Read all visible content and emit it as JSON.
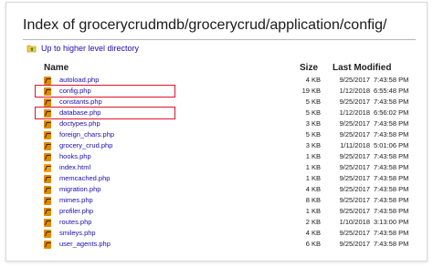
{
  "page": {
    "title": "Index of grocerycrudmdb/grocerycrud/application/config/",
    "up_link": "Up to higher level directory",
    "up_icon": "folder-up-icon"
  },
  "columns": {
    "name": "Name",
    "size": "Size",
    "modified": "Last Modified"
  },
  "colors": {
    "link": "#1a0dab",
    "highlight_border": "#e0142b",
    "file_icon": "#e08a00"
  },
  "files": [
    {
      "name": "autoload.php",
      "size": "4 KB",
      "date": "9/25/2017",
      "time": "7:43:58 PM",
      "icon": "php-file-icon"
    },
    {
      "name": "config.php",
      "size": "19 KB",
      "date": "1/12/2018",
      "time": "6:55:48 PM",
      "icon": "php-file-icon",
      "highlighted": true
    },
    {
      "name": "constants.php",
      "size": "5 KB",
      "date": "9/25/2017",
      "time": "7:43:58 PM",
      "icon": "php-file-icon"
    },
    {
      "name": "database.php",
      "size": "5 KB",
      "date": "1/12/2018",
      "time": "6:56:02 PM",
      "icon": "php-file-icon",
      "highlighted": true
    },
    {
      "name": "doctypes.php",
      "size": "3 KB",
      "date": "9/25/2017",
      "time": "7:43:58 PM",
      "icon": "php-file-icon"
    },
    {
      "name": "foreign_chars.php",
      "size": "5 KB",
      "date": "9/25/2017",
      "time": "7:43:58 PM",
      "icon": "php-file-icon"
    },
    {
      "name": "grocery_crud.php",
      "size": "3 KB",
      "date": "1/11/2018",
      "time": "5:01:06 PM",
      "icon": "php-file-icon"
    },
    {
      "name": "hooks.php",
      "size": "1 KB",
      "date": "9/25/2017",
      "time": "7:43:58 PM",
      "icon": "php-file-icon"
    },
    {
      "name": "index.html",
      "size": "1 KB",
      "date": "9/25/2017",
      "time": "7:43:58 PM",
      "icon": "html-file-icon"
    },
    {
      "name": "memcached.php",
      "size": "1 KB",
      "date": "9/25/2017",
      "time": "7:43:58 PM",
      "icon": "php-file-icon"
    },
    {
      "name": "migration.php",
      "size": "4 KB",
      "date": "9/25/2017",
      "time": "7:43:58 PM",
      "icon": "php-file-icon"
    },
    {
      "name": "mimes.php",
      "size": "8 KB",
      "date": "9/25/2017",
      "time": "7:43:58 PM",
      "icon": "php-file-icon"
    },
    {
      "name": "profiler.php",
      "size": "1 KB",
      "date": "9/25/2017",
      "time": "7:43:58 PM",
      "icon": "php-file-icon"
    },
    {
      "name": "routes.php",
      "size": "2 KB",
      "date": "1/10/2018",
      "time": "3:13:00 PM",
      "icon": "php-file-icon"
    },
    {
      "name": "smileys.php",
      "size": "4 KB",
      "date": "9/25/2017",
      "time": "7:43:58 PM",
      "icon": "php-file-icon"
    },
    {
      "name": "user_agents.php",
      "size": "6 KB",
      "date": "9/25/2017",
      "time": "7:43:58 PM",
      "icon": "php-file-icon"
    }
  ]
}
